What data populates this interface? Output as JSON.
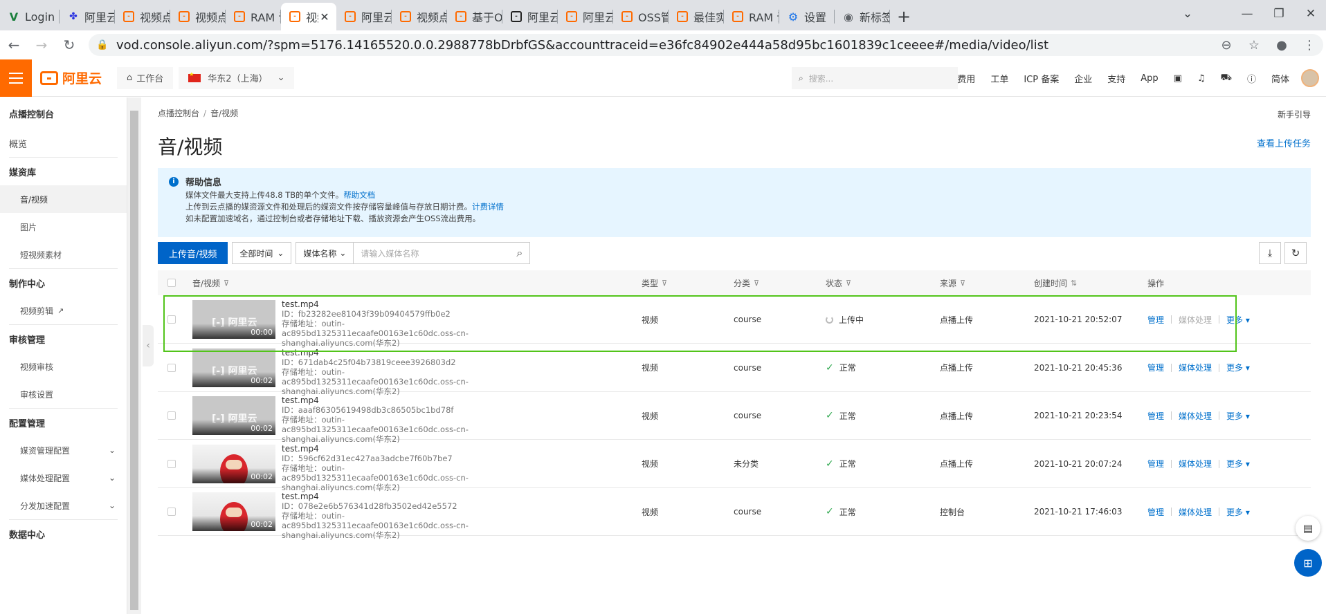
{
  "browser": {
    "tabs": [
      {
        "icon": "vue-icon",
        "label": "Login I"
      },
      {
        "icon": "baidu-icon",
        "label": "阿里云"
      },
      {
        "icon": "aliyun-icon",
        "label": "视频点"
      },
      {
        "icon": "aliyun-icon",
        "label": "视频点"
      },
      {
        "icon": "aliyun-icon",
        "label": "RAM 访"
      },
      {
        "icon": "aliyun-icon",
        "label": "视频",
        "close": "✕"
      },
      {
        "icon": "aliyun-icon",
        "label": "阿里云"
      },
      {
        "icon": "aliyun-icon",
        "label": "视频点"
      },
      {
        "icon": "aliyun-icon",
        "label": "基于OS"
      },
      {
        "icon": "aliyun-black-icon",
        "label": "阿里云"
      },
      {
        "icon": "aliyun-icon",
        "label": "阿里云"
      },
      {
        "icon": "aliyun-icon",
        "label": "OSS管"
      },
      {
        "icon": "aliyun-icon",
        "label": "最佳实"
      },
      {
        "icon": "aliyun-icon",
        "label": "RAM 访"
      },
      {
        "icon": "gear-icon",
        "label": "设置"
      },
      {
        "icon": "globe-icon",
        "label": "新标签"
      }
    ],
    "new_tab": "+",
    "url": "vod.console.aliyun.com/?spm=5176.14165520.0.0.2988778bDrbfGS&accounttraceid=e36fc84902e444a58d95bc1601839c1ceeee#/media/video/list"
  },
  "topbar": {
    "brand": "阿里云",
    "workbench": "工作台",
    "region": "华东2（上海）",
    "search_placeholder": "搜索...",
    "links": [
      "费用",
      "工单",
      "ICP 备案",
      "企业",
      "支持",
      "App"
    ],
    "lang": "简体"
  },
  "sidebar": {
    "title": "点播控制台",
    "overview": "概览",
    "groups": [
      {
        "title": "媒资库",
        "items": [
          "音/视频",
          "图片",
          "短视频素材"
        ]
      },
      {
        "title": "制作中心",
        "items": [
          "视频剪辑"
        ]
      },
      {
        "title": "审核管理",
        "items": [
          "视频审核",
          "审核设置"
        ]
      },
      {
        "title": "配置管理",
        "items": [
          "媒资管理配置",
          "媒体处理配置",
          "分发加速配置"
        ]
      },
      {
        "title": "数据中心",
        "items": []
      }
    ]
  },
  "main": {
    "breadcrumb": [
      "点播控制台",
      "音/视频"
    ],
    "guide": "新手引导",
    "title": "音/视频",
    "upload_tasks": "查看上传任务",
    "help": {
      "title": "帮助信息",
      "line1": "媒体文件最大支持上传48.8 TB的单个文件。",
      "line1_link": "帮助文档",
      "line2": "上传到云点播的媒资源文件和处理后的媒资文件按存储容量峰值与存放日期计费。",
      "line2_link": "计费详情",
      "line3": "如未配置加速域名，通过控制台或者存储地址下载、播放资源会产生OSS流出费用。"
    },
    "upload_btn": "上传音/视频",
    "time_filter": "全部时间",
    "field_select": "媒体名称",
    "search_placeholder": "请输入媒体名称",
    "columns": [
      "音/视频",
      "类型",
      "分类",
      "状态",
      "来源",
      "创建时间",
      "操作"
    ],
    "rows": [
      {
        "name": "test.mp4",
        "id": "ID：fb23282ee81043f39b09404579ffb0e2",
        "store1": "存储地址：outin-ac895bd1325311ecaafe00163e1c60dc.oss-cn-",
        "store2": "shanghai.aliyuncs.com(华东2)",
        "duration": "00:00",
        "type": "视频",
        "category": "course",
        "status": "上传中",
        "source": "点播上传",
        "created": "2021-10-21 20:52:07",
        "thumb": "grey"
      },
      {
        "name": "test.mp4",
        "id": "ID：671dab4c25f04b73819ceee3926803d2",
        "store1": "存储地址：outin-ac895bd1325311ecaafe00163e1c60dc.oss-cn-",
        "store2": "shanghai.aliyuncs.com(华东2)",
        "duration": "00:02",
        "type": "视频",
        "category": "course",
        "status": "正常",
        "source": "点播上传",
        "created": "2021-10-21 20:45:36",
        "thumb": "grey"
      },
      {
        "name": "test.mp4",
        "id": "ID：aaaf86305619498db3c86505bc1bd78f",
        "store1": "存储地址：outin-ac895bd1325311ecaafe00163e1c60dc.oss-cn-",
        "store2": "shanghai.aliyuncs.com(华东2)",
        "duration": "00:02",
        "type": "视频",
        "category": "course",
        "status": "正常",
        "source": "点播上传",
        "created": "2021-10-21 20:23:54",
        "thumb": "grey"
      },
      {
        "name": "test.mp4",
        "id": "ID：596cf62d31ec427aa3adcbe7f60b7be7",
        "store1": "存储地址：outin-ac895bd1325311ecaafe00163e1c60dc.oss-cn-",
        "store2": "shanghai.aliyuncs.com(华东2)",
        "duration": "00:02",
        "type": "视频",
        "category": "未分类",
        "status": "正常",
        "source": "点播上传",
        "created": "2021-10-21 20:07:24",
        "thumb": "figure"
      },
      {
        "name": "test.mp4",
        "id": "ID：078e2e6b576341d28fb3502ed42e5572",
        "store1": "存储地址：outin-ac895bd1325311ecaafe00163e1c60dc.oss-cn-",
        "store2": "shanghai.aliyuncs.com(华东2)",
        "duration": "00:02",
        "type": "视频",
        "category": "course",
        "status": "正常",
        "source": "控制台",
        "created": "2021-10-21 17:46:03",
        "thumb": "figure"
      }
    ],
    "op_manage": "管理",
    "op_process": "媒体处理",
    "op_more": "更多"
  },
  "colors": {
    "brand": "#ff6a00",
    "primary": "#0064c8",
    "link": "#0070cc",
    "success": "#2fa84f",
    "highlight": "#52c41a"
  }
}
